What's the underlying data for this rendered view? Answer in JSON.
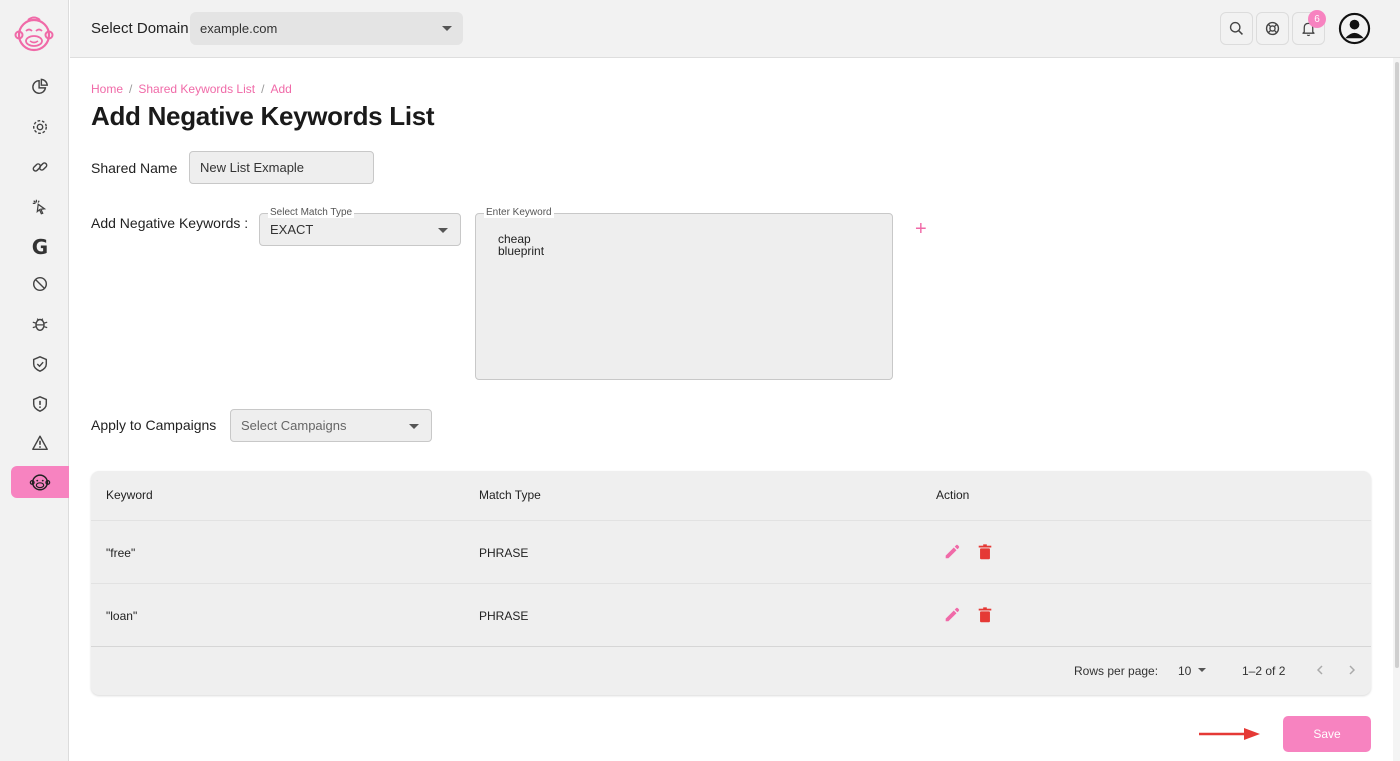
{
  "header": {
    "domain_label": "Select Domain",
    "domain_value": "example.com",
    "notification_count": "6"
  },
  "sidebar": {
    "items": [
      {
        "icon": "pie-chart-icon"
      },
      {
        "icon": "gear-icon"
      },
      {
        "icon": "link-icon"
      },
      {
        "icon": "click-icon"
      },
      {
        "icon": "google-icon",
        "label": "G"
      },
      {
        "icon": "block-icon"
      },
      {
        "icon": "bug-icon"
      },
      {
        "icon": "shield-check-icon"
      },
      {
        "icon": "shield-alert-icon"
      },
      {
        "icon": "warning-icon"
      },
      {
        "icon": "monkey-face-icon",
        "active": true
      }
    ]
  },
  "breadcrumb": {
    "home": "Home",
    "list": "Shared Keywords List",
    "current": "Add",
    "separator": "/"
  },
  "page_title": "Add Negative Keywords List",
  "form": {
    "shared_name_label": "Shared Name",
    "shared_name_value": "New List Exmaple",
    "negative_keywords_label": "Add Negative Keywords :",
    "match_type_legend": "Select Match Type",
    "match_type_value": "EXACT",
    "keyword_legend": "Enter Keyword",
    "keyword_lines": [
      "cheap",
      "blueprint"
    ],
    "add_symbol": "+",
    "apply_label": "Apply to Campaigns",
    "campaigns_placeholder": "Select Campaigns"
  },
  "table": {
    "headers": {
      "keyword": "Keyword",
      "match_type": "Match Type",
      "action": "Action"
    },
    "rows": [
      {
        "keyword": "\"free\"",
        "match_type": "PHRASE"
      },
      {
        "keyword": "\"loan\"",
        "match_type": "PHRASE"
      }
    ],
    "footer": {
      "rows_per_page_label": "Rows per page:",
      "rows_per_page_value": "10",
      "range": "1–2 of 2"
    }
  },
  "save_label": "Save",
  "colors": {
    "accent": "#f783c0",
    "delete": "#e53935",
    "annotation_arrow": "#e53935"
  }
}
